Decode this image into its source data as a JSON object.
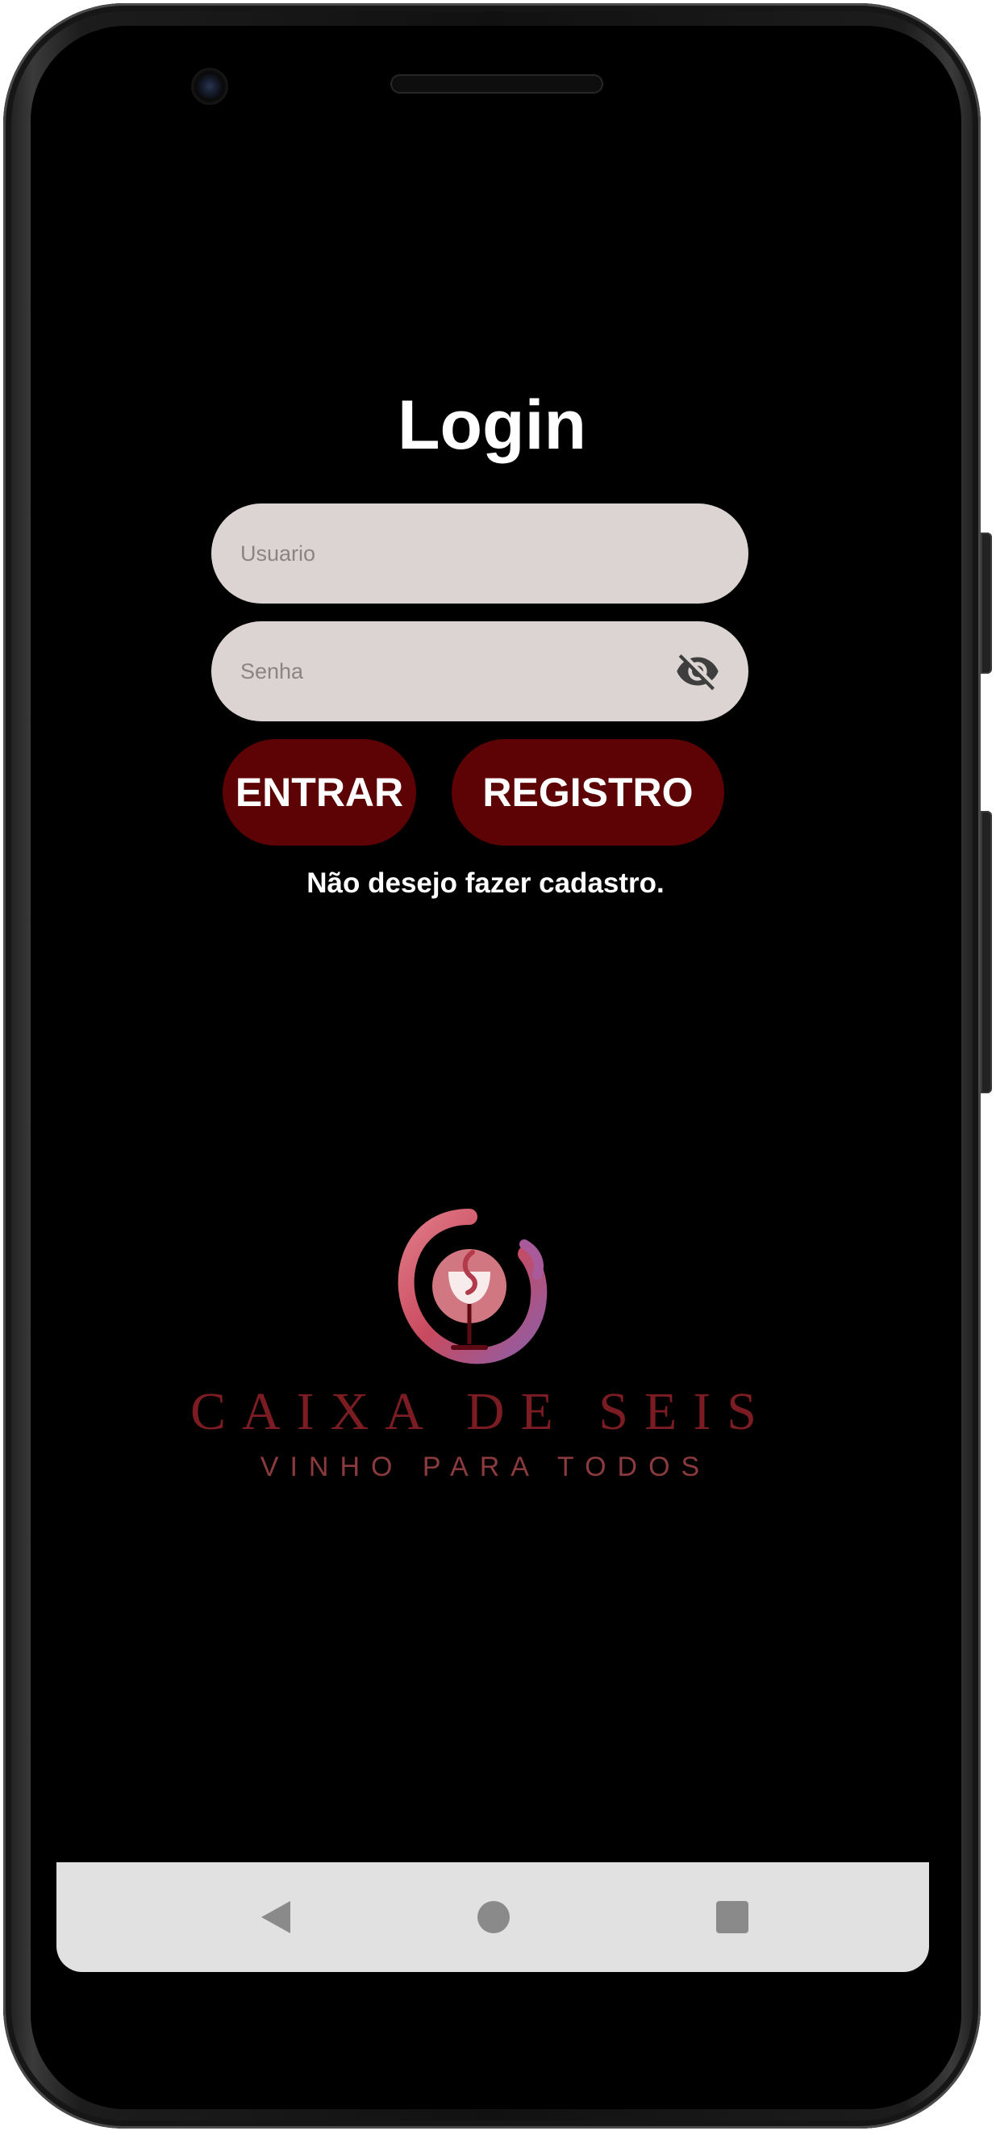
{
  "login": {
    "title": "Login",
    "username_placeholder": "Usuario",
    "password_placeholder": "Senha",
    "enter_label": "ENTRAR",
    "register_label": "REGISTRO",
    "no_register_text": "Não desejo fazer cadastro."
  },
  "brand": {
    "name": "CAIXA DE SEIS",
    "tagline": "VINHO PARA TODOS"
  },
  "icons": {
    "password_toggle": "eye-off-icon",
    "nav_back": "triangle-back-icon",
    "nav_home": "circle-home-icon",
    "nav_recents": "square-recents-icon"
  },
  "colors": {
    "background": "#000000",
    "button": "#5d0306",
    "field": "#dcd4d3",
    "brand": "#7a1c22"
  }
}
